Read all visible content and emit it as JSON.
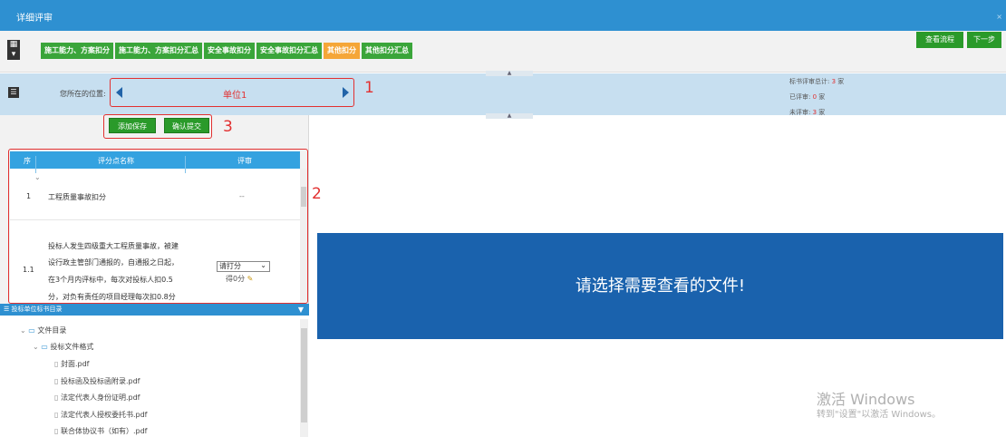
{
  "window": {
    "title": "详细评审",
    "close": "×"
  },
  "toolbar": {
    "menu_icon": "grid-menu-icon",
    "tabs": [
      {
        "label": "施工能力、方案扣分",
        "active": false
      },
      {
        "label": "施工能力、方案扣分汇总",
        "active": false
      },
      {
        "label": "安全事故扣分",
        "active": false
      },
      {
        "label": "安全事故扣分汇总",
        "active": false
      },
      {
        "label": "其他扣分",
        "active": true
      },
      {
        "label": "其他扣分汇总",
        "active": false
      }
    ],
    "view_flow_label": "查看流程",
    "next_label": "下一步"
  },
  "position": {
    "label": "您所在的位置:",
    "unit": "单位1",
    "annotation_1": "1"
  },
  "stats": {
    "total_label": "标书评审总计:",
    "total_value": "3",
    "total_unit": "家",
    "reviewed_label": "已评审:",
    "reviewed_value": "0",
    "reviewed_unit": "家",
    "unreviewed_label": "未评审:",
    "unreviewed_value": "3",
    "unreviewed_unit": "家"
  },
  "actions": {
    "save_label": "添加保存",
    "submit_label": "确认提交",
    "annotation_3": "3"
  },
  "grid": {
    "annotation_2": "2",
    "columns": [
      "序",
      "评分点名称",
      "评审"
    ],
    "rows": [
      {
        "seq": "1",
        "name": "工程质量事故扣分",
        "review": "--"
      },
      {
        "seq": "1.1",
        "name_lines": [
          "投标人发生四级重大工程质量事故，被建",
          "设行政主管部门通报的，自通报之日起，",
          "在3个月内评标中，每次对投标人扣0.5",
          "分，对负有责任的项目经理每次扣0.8分"
        ],
        "select_value": "请打分",
        "score": "得0分"
      }
    ]
  },
  "tree": {
    "header": "投标单位标书目录",
    "root": "文件目录",
    "folder": "投标文件格式",
    "files": [
      "封面.pdf",
      "投标函及投标函附录.pdf",
      "法定代表人身份证明.pdf",
      "法定代表人授权委托书.pdf",
      "联合体协议书（如有）.pdf"
    ]
  },
  "viewer": {
    "message": "请选择需要查看的文件!"
  },
  "watermark": {
    "line1": "激活 Windows",
    "line2": "转到\"设置\"以激活 Windows。"
  },
  "colors": {
    "titlebar": "#2e90d1",
    "green": "#2a9a2a",
    "orange": "#f5a638",
    "banner": "#1a62ad",
    "annotation": "#e23030"
  }
}
